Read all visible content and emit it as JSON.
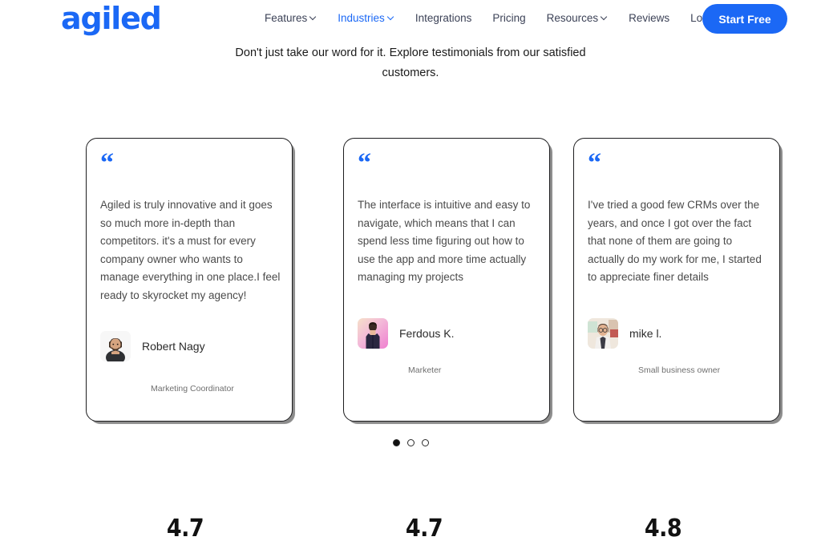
{
  "header": {
    "logo": "agiled",
    "nav": [
      {
        "label": "Features",
        "has_caret": true,
        "active": false
      },
      {
        "label": "Industries",
        "has_caret": true,
        "active": true
      },
      {
        "label": "Integrations",
        "has_caret": false,
        "active": false
      },
      {
        "label": "Pricing",
        "has_caret": false,
        "active": false
      },
      {
        "label": "Resources",
        "has_caret": true,
        "active": false
      },
      {
        "label": "Reviews",
        "has_caret": false,
        "active": false
      },
      {
        "label": "Login",
        "has_caret": false,
        "active": false
      }
    ],
    "cta_label": "Start Free",
    "accent_color": "#1B68F5"
  },
  "subtitle": "Don't just take our word for it. Explore testimonials  from our satisfied customers.",
  "testimonials": [
    {
      "quote_mark": "“",
      "quote": "Agiled is truly innovative and it goes so much more in-depth than competitors. it's a must for every company owner who wants to manage everything in one place.I feel ready to skyrocket my agency!",
      "name": "Robert Nagy",
      "role": "Marketing Coordinator",
      "avatar": "photo-man-beard-dark-shirt"
    },
    {
      "quote_mark": "“",
      "quote": "The interface is intuitive and easy to navigate, which means that I can spend less time figuring out how to use the app and more time actually managing my projects",
      "name": "Ferdous K.",
      "role": "Marketer",
      "avatar": "photo-person-pink-gradient-background"
    },
    {
      "quote_mark": "“",
      "quote": "I've tried a good few CRMs over the years, and once I got over the fact that none of them are going to actually do my work for me, I started to appreciate finer details",
      "name": "mike l.",
      "role": "Small business owner",
      "avatar": "photo-man-glasses-shirt-tie"
    }
  ],
  "carousel": {
    "dots": [
      {
        "active": true
      },
      {
        "active": false
      },
      {
        "active": false
      }
    ]
  },
  "ratings": [
    {
      "value": "4.7"
    },
    {
      "value": "4.7"
    },
    {
      "value": "4.8"
    }
  ]
}
